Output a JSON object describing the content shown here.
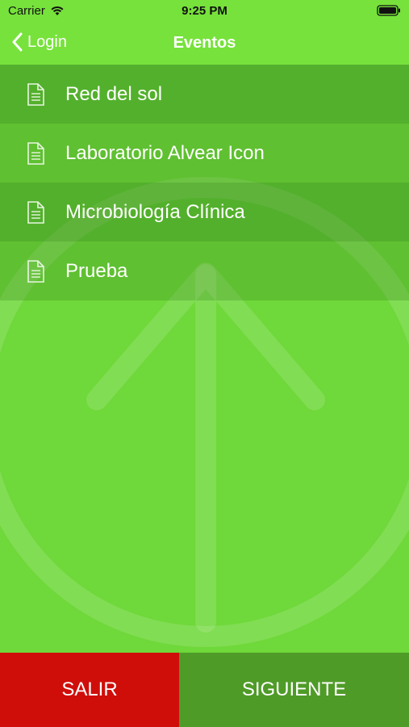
{
  "status": {
    "carrier": "Carrier",
    "time": "9:25 PM"
  },
  "nav": {
    "back_label": "Login",
    "title": "Eventos"
  },
  "events": [
    {
      "label": "Red del sol",
      "icon": "document-icon"
    },
    {
      "label": "Laboratorio Alvear Icon",
      "icon": "document-icon"
    },
    {
      "label": "Microbiología Clínica",
      "icon": "document-icon"
    },
    {
      "label": "Prueba",
      "icon": "document-icon"
    }
  ],
  "buttons": {
    "exit": "SALIR",
    "next": "SIGUIENTE"
  },
  "colors": {
    "background": "#6fd83a",
    "bar": "#77e23b",
    "exit": "#cf0e0a",
    "next": "#4f9b28"
  }
}
